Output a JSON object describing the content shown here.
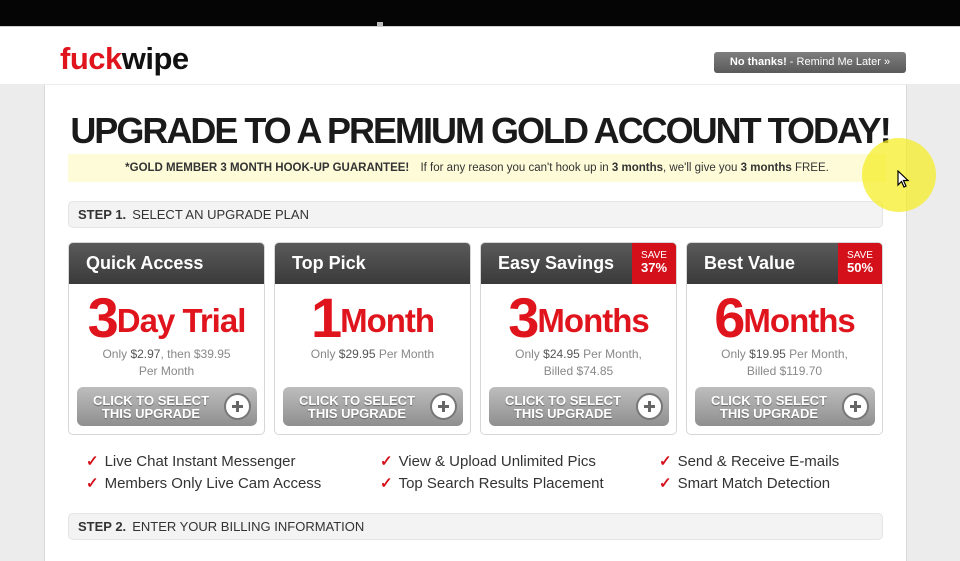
{
  "header": {
    "logo_part1": "fuck",
    "logo_part2": "wipe",
    "remind_bold": "No thanks!",
    "remind_rest": " - Remind Me Later »"
  },
  "headline": "UPGRADE TO A PREMIUM GOLD ACCOUNT TODAY!",
  "guarantee": {
    "lead": "*GOLD MEMBER 3 MONTH HOOK-UP GUARANTEE!",
    "t1": "If for any reason you can't hook up in ",
    "b1": "3 months",
    "t2": ", we'll give you ",
    "b2": "3 months",
    "t3": " FREE."
  },
  "step1": {
    "num": "STEP 1.",
    "label": "SELECT AN UPGRADE PLAN"
  },
  "step2": {
    "num": "STEP 2.",
    "label": "ENTER YOUR BILLING INFORMATION"
  },
  "plans": [
    {
      "name": "Quick Access",
      "number": "3",
      "unit": "Day Trial",
      "price_prefix": "Only ",
      "price": "$2.97",
      "price_suffix": ", then $39.95",
      "line2": "Per Month",
      "save_label": "",
      "save_pct": "",
      "button_label1": "CLICK TO SELECT",
      "button_label2": "THIS UPGRADE"
    },
    {
      "name": "Top Pick",
      "number": "1",
      "unit": "Month",
      "price_prefix": "Only ",
      "price": "$29.95",
      "price_suffix": " Per Month",
      "line2": "",
      "save_label": "",
      "save_pct": "",
      "button_label1": "CLICK TO SELECT",
      "button_label2": "THIS UPGRADE"
    },
    {
      "name": "Easy Savings",
      "number": "3",
      "unit": "Months",
      "price_prefix": "Only ",
      "price": "$24.95",
      "price_suffix": " Per Month,",
      "line2": "Billed $74.85",
      "save_label": "SAVE",
      "save_pct": "37%",
      "button_label1": "CLICK TO SELECT",
      "button_label2": "THIS UPGRADE"
    },
    {
      "name": "Best Value",
      "number": "6",
      "unit": "Months",
      "price_prefix": "Only ",
      "price": "$19.95",
      "price_suffix": " Per Month,",
      "line2": "Billed $119.70",
      "save_label": "SAVE",
      "save_pct": "50%",
      "button_label1": "CLICK TO SELECT",
      "button_label2": "THIS UPGRADE"
    }
  ],
  "features": [
    "Live Chat Instant Messenger",
    "View & Upload Unlimited Pics",
    "Send & Receive E-mails",
    "Members Only Live Cam Access",
    "Top Search Results Placement",
    "Smart Match Detection"
  ],
  "check_glyph": "✓",
  "colors": {
    "accent_red": "#e0141c",
    "dark_header": "#3a3a3a",
    "guarantee_bg": "#fdfbd8",
    "cursor_highlight": "#f5ee28"
  }
}
